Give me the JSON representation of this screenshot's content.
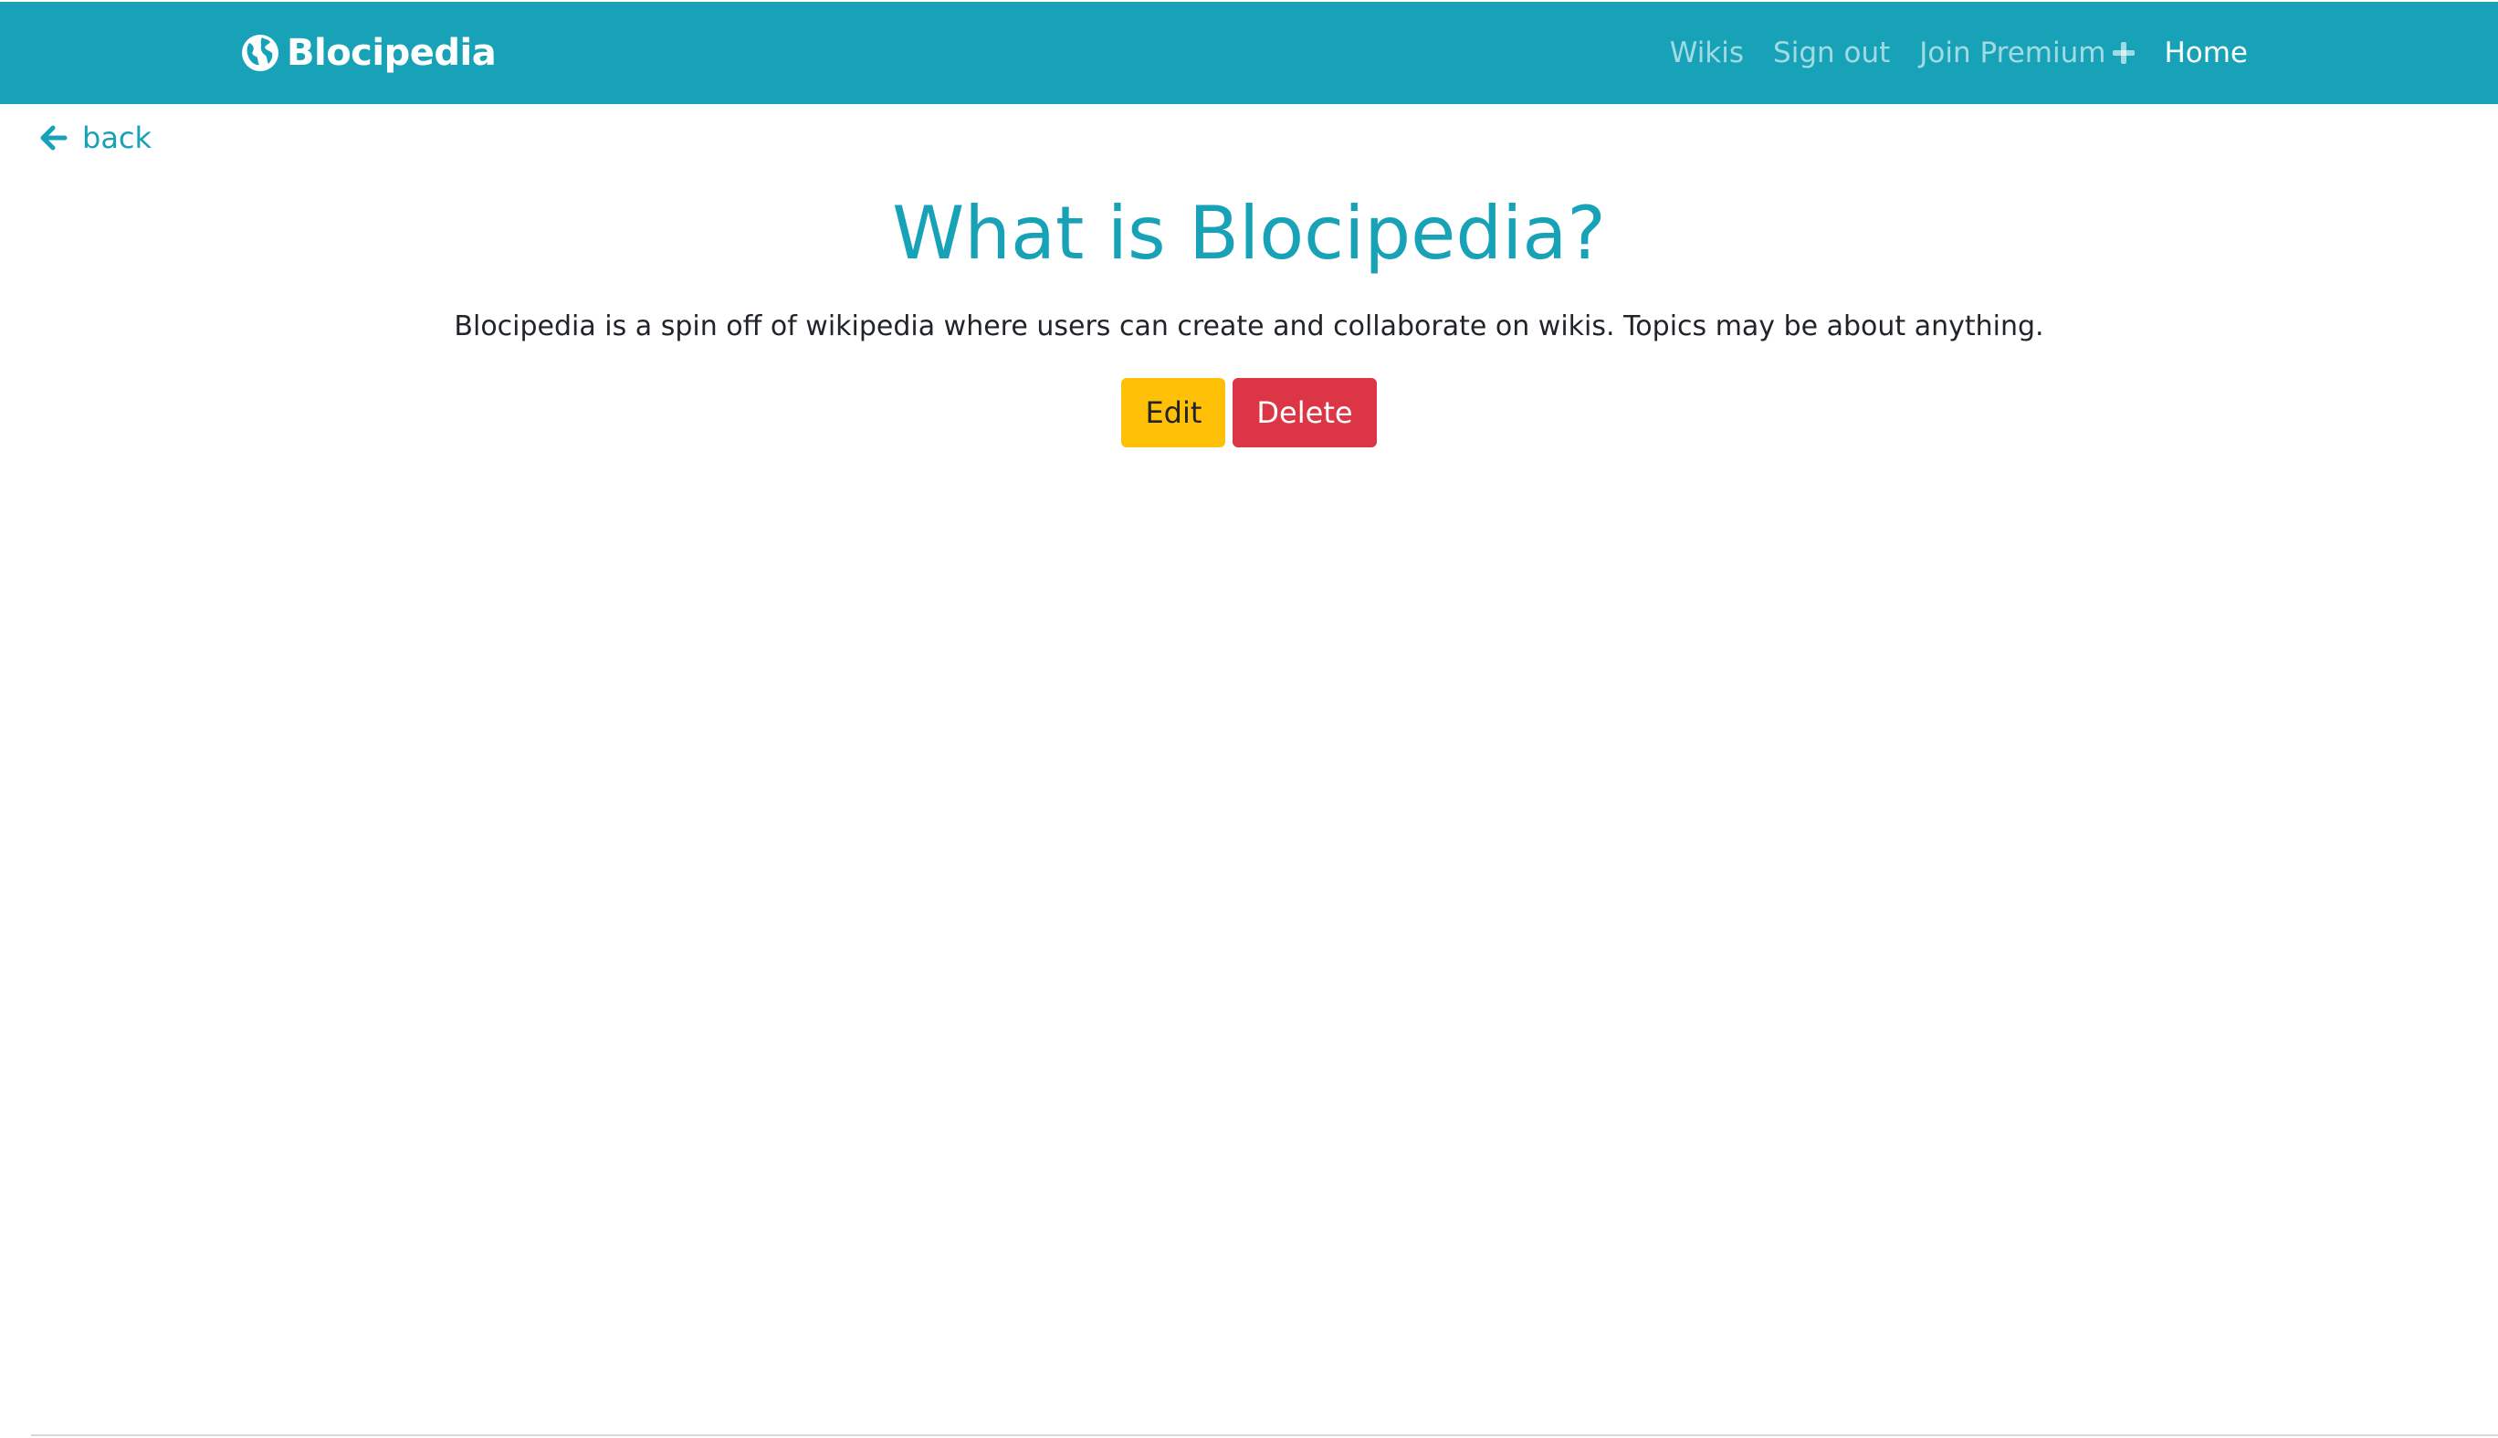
{
  "navbar": {
    "brand": "Blocipedia",
    "links": {
      "wikis": "Wikis",
      "sign_out": "Sign out",
      "join_premium": "Join Premium",
      "home": "Home"
    }
  },
  "back_label": "back",
  "wiki": {
    "title": "What is Blocipedia?",
    "body": "Blocipedia is a spin off of wikipedia where users can create and collaborate on wikis. Topics may be about anything."
  },
  "actions": {
    "edit_label": "Edit",
    "delete_label": "Delete"
  },
  "colors": {
    "primary": "#17a2b8",
    "warning": "#ffc107",
    "danger": "#dc3545"
  },
  "icons": {
    "brand": "globe-icon",
    "back": "arrow-left-icon",
    "premium": "plus-icon"
  }
}
